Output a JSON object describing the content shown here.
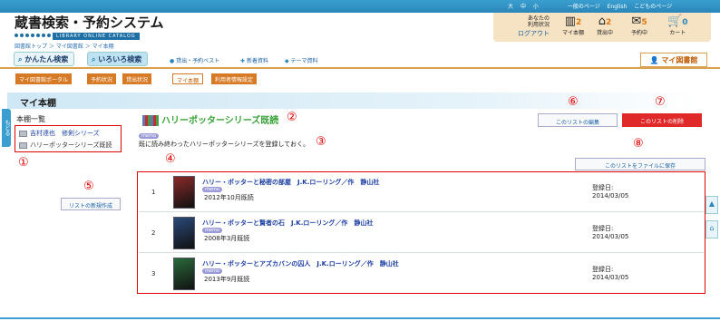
{
  "header": {
    "logo_jp": "蔵書検索・予約システム",
    "logo_en": "LIBRARY ONLINE CATALOG",
    "font_sizes": [
      "大",
      "中",
      "小"
    ],
    "links": [
      "一般のページ",
      "English",
      "こどものページ"
    ],
    "user_status": "あなたの\n利用状況",
    "logout": "ログアウト",
    "counters": [
      {
        "icon": "bookshelf-icon",
        "count": "2",
        "label": "マイ本棚"
      },
      {
        "icon": "house-icon",
        "count": "2",
        "label": "貸出中"
      },
      {
        "icon": "reserve-icon",
        "count": "5",
        "label": "予約中"
      },
      {
        "icon": "cart-icon",
        "count": "0",
        "label": "カート"
      }
    ]
  },
  "breadcrumb": "図書館トップ ＞ マイ図書館 ＞ マイ本棚",
  "search_tabs": {
    "simple": "かんたん検索",
    "advanced": "いろいろ検索",
    "links": [
      "貸出・予約ベスト",
      "新着資料",
      "テーマ資料"
    ],
    "mylib": "マイ図書館"
  },
  "subtabs": [
    "マイ図書館ポータル",
    "予約状況",
    "貸出状況",
    "マイ本棚",
    "利用者情報設定"
  ],
  "page_title": "マイ本棚",
  "side_tab": "もどる",
  "sidebar": {
    "title": "本棚一覧",
    "items": [
      "吉村達也　修剣シリーズ",
      "ハリーポッターシリーズ既読"
    ],
    "new_list": "リストの新規作成"
  },
  "list": {
    "title": "ハリーポッターシリーズ既読",
    "memo_badge": "memo",
    "memo": "既に読み終わったハリーポッターシリーズを登録しておく。",
    "edit": "このリストの編集",
    "delete": "このリストの削除",
    "save": "このリストをファイルに保存",
    "reg_label": "登録日:",
    "books": [
      {
        "num": "1",
        "title": "ハリー・ポッターと秘密の部屋　J.K.ローリング／作　静山社",
        "read": "2012年10月既読",
        "date": "2014/03/05",
        "cover": "#8a2a2a"
      },
      {
        "num": "2",
        "title": "ハリー・ポッターと賢者の石　J.K.ローリング／作　静山社",
        "read": "2008年3月既読",
        "date": "2014/03/05",
        "cover": "#2a4a7a"
      },
      {
        "num": "3",
        "title": "ハリー・ポッターとアズカバンの囚人　J.K.ローリング／作　静山社",
        "read": "2013年9月既読",
        "date": "2014/03/05",
        "cover": "#2a6a3a"
      }
    ]
  },
  "callouts": [
    "①",
    "②",
    "③",
    "④",
    "⑤",
    "⑥",
    "⑦",
    "⑧"
  ],
  "side_buttons": [
    "page-top-icon",
    "home-icon"
  ],
  "colors": {
    "accent": "#2a86b8",
    "brand_orange": "#d77a25",
    "highlight_red": "#e00000",
    "title_green": "#3aa23a"
  }
}
